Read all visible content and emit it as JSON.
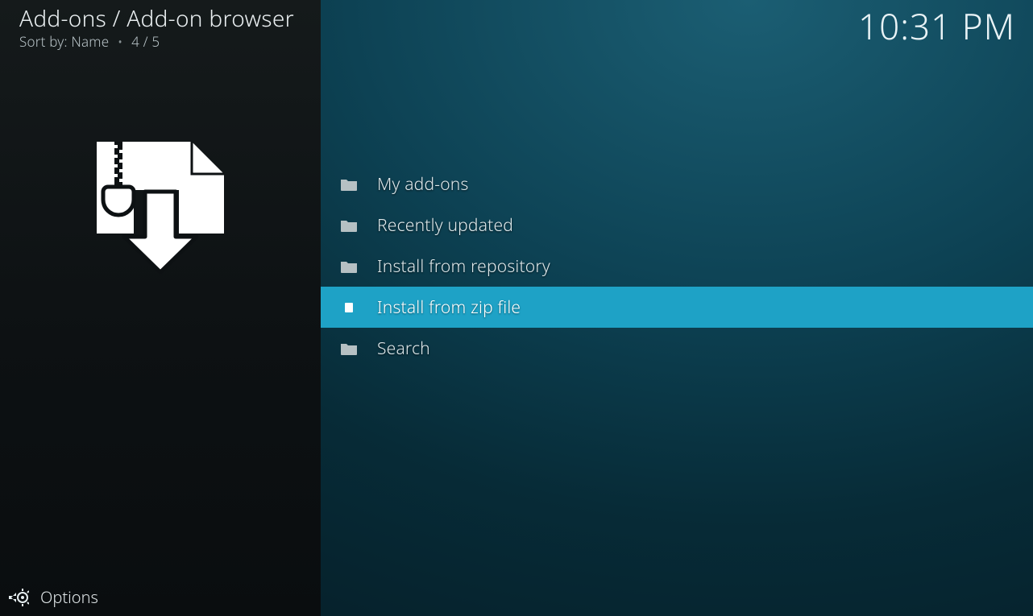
{
  "header": {
    "breadcrumb": "Add-ons / Add-on browser",
    "sort_label": "Sort by:",
    "sort_value": "Name",
    "position": "4 / 5",
    "clock": "10:31 PM"
  },
  "sidebar": {
    "options_label": "Options",
    "artwork": "zip-download-icon"
  },
  "menu": {
    "selected_index": 3,
    "items": [
      {
        "label": "My add-ons",
        "icon": "folder-icon"
      },
      {
        "label": "Recently updated",
        "icon": "folder-icon"
      },
      {
        "label": "Install from repository",
        "icon": "folder-icon"
      },
      {
        "label": "Install from zip file",
        "icon": "file-icon"
      },
      {
        "label": "Search",
        "icon": "folder-icon"
      }
    ]
  },
  "colors": {
    "accent": "#1ea2c6",
    "panel": "#0d1113",
    "bg": "#0a3a47"
  }
}
